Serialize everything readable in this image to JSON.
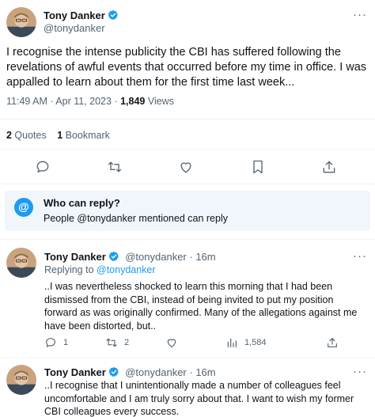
{
  "main_tweet": {
    "author_name": "Tony Danker",
    "author_handle": "@tonydanker",
    "text": "I recognise the intense publicity the CBI has suffered following the revelations of awful events that occurred before my time in office. I was appalled to learn about them for the first time last week...",
    "time": "11:49 AM · Apr 11, 2023 · ",
    "views_count": "1,849",
    "views_label": " Views",
    "quotes_count": "2",
    "quotes_label": " Quotes",
    "bookmarks_count": "1",
    "bookmarks_label": " Bookmark",
    "actions": [
      "comment-icon",
      "retweet-icon",
      "like-icon",
      "bookmark-icon",
      "share-icon"
    ]
  },
  "reply_settings": {
    "icon_text": "@",
    "title": "Who can reply?",
    "subtitle": "People @tonydanker mentioned can reply"
  },
  "replies": [
    {
      "author_name": "Tony Danker",
      "author_handle": "@tonydanker",
      "time": " · 16m",
      "replying_prefix": "Replying to ",
      "replying_to": "@tonydanker",
      "text": "..I was nevertheless shocked to learn this morning that I had been dismissed from the CBI, instead of being invited to put my position forward as was originally confirmed. Many of the allegations against me have been distorted, but..",
      "reply_count": "1",
      "retweet_count": "2",
      "like_count": "",
      "views_count": "1,584"
    },
    {
      "author_name": "Tony Danker",
      "author_handle": "@tonydanker",
      "time": " · 16m",
      "text": "..I recognise that I unintentionally made a number of colleagues feel uncomfortable and I am truly sorry about that. I want to wish my former CBI colleagues every success."
    }
  ],
  "more_label": "···",
  "colors": {
    "accent": "#1d9bf0",
    "muted": "#536471",
    "reply_box_bg": "#f0f6fb"
  }
}
